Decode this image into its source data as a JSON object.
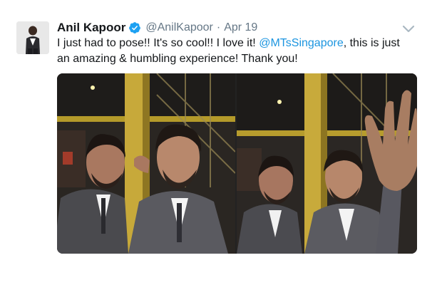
{
  "tweet": {
    "author_name": "Anil Kapoor",
    "handle": "@AnilKapoor",
    "separator": "·",
    "date": "Apr 19",
    "text_before": "I just had to pose!! It's so cool!! I love it! ",
    "mention": "@MTsSingapore",
    "text_after": ", this is just an amazing & humbling experience! Thank you!"
  },
  "icons": {
    "verified": "verified-badge-icon",
    "menu": "chevron-down-icon"
  },
  "colors": {
    "link": "#1b95e0",
    "verified": "#1da1f2",
    "secondary_text": "#657786"
  }
}
